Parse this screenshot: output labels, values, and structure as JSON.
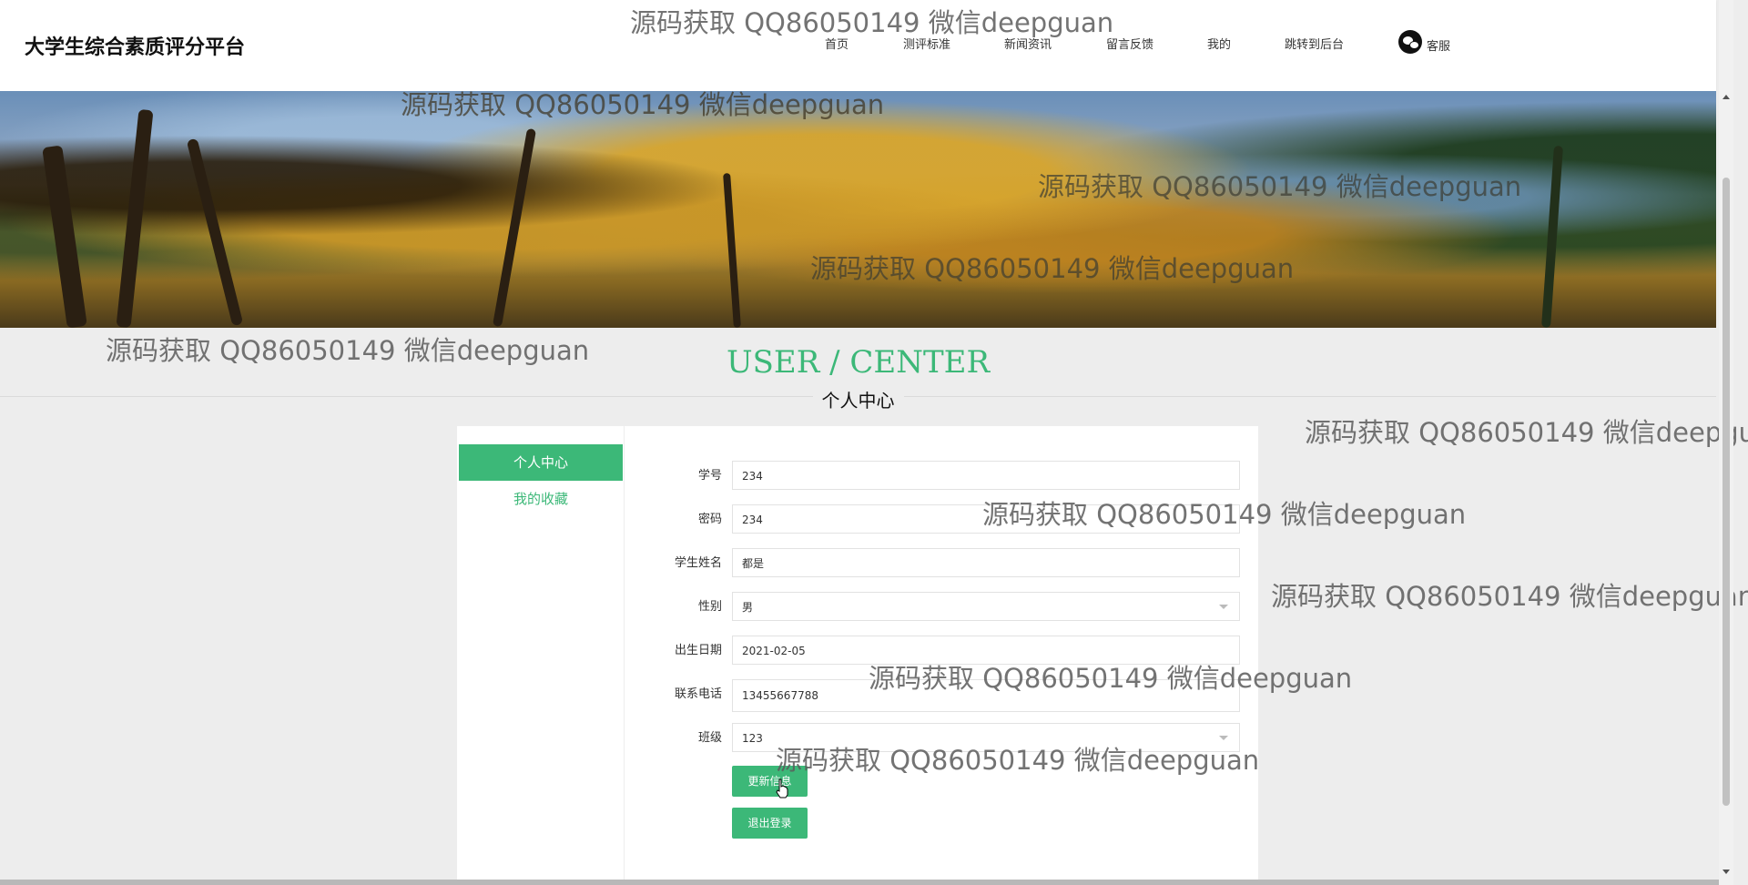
{
  "header": {
    "brand": "大学生综合素质评分平台",
    "nav": [
      "首页",
      "测评标准",
      "新闻资讯",
      "留言反馈",
      "我的",
      "跳转到后台"
    ],
    "customer_service": "客服"
  },
  "section": {
    "title_en": "USER / CENTER",
    "title_cn": "个人中心"
  },
  "sidebar": {
    "items": [
      {
        "label": "个人中心"
      },
      {
        "label": "我的收藏"
      }
    ]
  },
  "form": {
    "fields": [
      {
        "label": "学号",
        "value": "234"
      },
      {
        "label": "密码",
        "value": "234"
      },
      {
        "label": "学生姓名",
        "value": "都是"
      },
      {
        "label": "性别",
        "value": "男"
      },
      {
        "label": "出生日期",
        "value": "2021-02-05"
      },
      {
        "label": "联系电话",
        "value": "13455667788"
      },
      {
        "label": "班级",
        "value": "123"
      }
    ],
    "update_button": "更新信息",
    "logout_button": "退出登录"
  },
  "watermark": "源码获取 QQ86050149 微信deepguan",
  "colors": {
    "accent": "#3cb878",
    "page_bg": "#ededed"
  }
}
